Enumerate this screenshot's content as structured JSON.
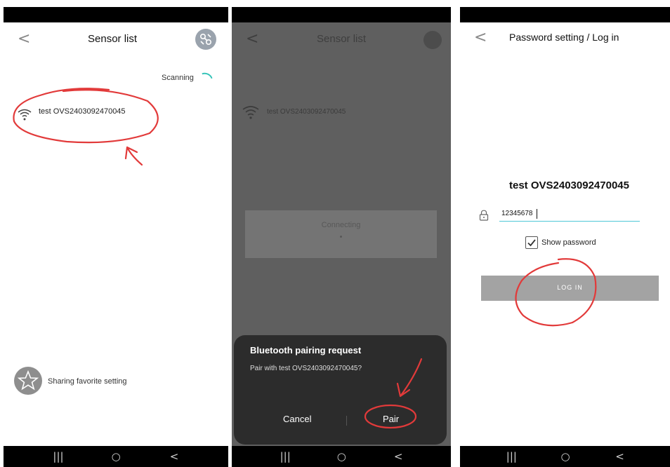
{
  "panel1": {
    "back_glyph": "<",
    "title": "Sensor list",
    "scanning_label": "Scanning",
    "sensor_name": "test OVS2403092470045",
    "share_label": "Sharing favorite setting"
  },
  "panel2": {
    "back_glyph": "<",
    "title": "Sensor list",
    "sensor_name": "test OVS2403092470045",
    "connecting_label": "Connecting",
    "dialog": {
      "title": "Bluetooth pairing request",
      "message": "Pair with test OVS2403092470045?",
      "cancel_label": "Cancel",
      "pair_label": "Pair"
    }
  },
  "panel3": {
    "back_glyph": "<",
    "title": "Password setting / Log in",
    "device_name": "test OVS2403092470045",
    "password_value": "12345678",
    "show_password_label": "Show password",
    "show_password_checked": true,
    "login_label": "LOG IN"
  },
  "navbar": {
    "recents_glyph": "|||",
    "home_glyph": "○",
    "back_glyph": "<"
  },
  "colors": {
    "annotation_red": "#e23a3a",
    "accent_teal": "#34c3b8",
    "field_underline": "#4fc7d6",
    "login_button": "#a3a3a3",
    "dialog_bg": "#2c2c2c",
    "dimmed_bg": "#5f5f5f"
  },
  "icons": [
    "settings-icon",
    "wifi-signal-icon",
    "star-icon",
    "lock-icon",
    "checkbox-check-icon",
    "scanning-spinner-icon"
  ]
}
